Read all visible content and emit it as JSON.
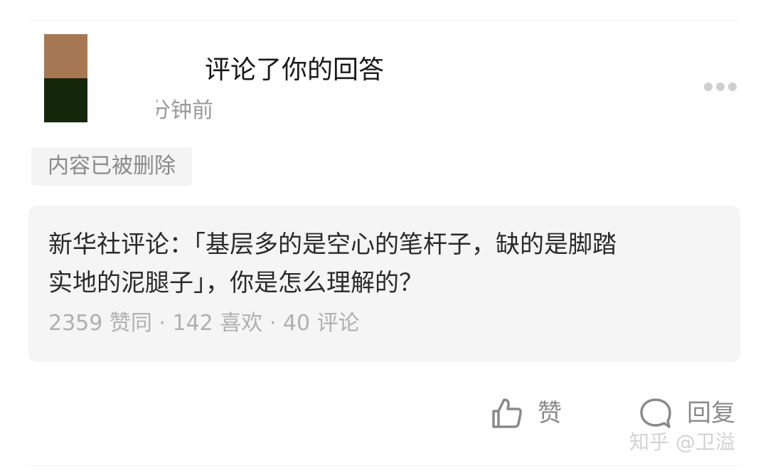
{
  "notification": {
    "action_text": "评论了你的回答",
    "time_suffix": "分钟前"
  },
  "deleted_tag": "内容已被删除",
  "question": {
    "title_line1": "新华社评论：「基层多的是空心的笔杆子，缺的是脚踏",
    "title_line2": "实地的泥腿子」，你是怎么理解的？",
    "stats": "2359 赞同 · 142 喜欢 · 40 评论"
  },
  "actions": {
    "like_label": "赞",
    "reply_label": "回复"
  },
  "watermark": "知乎 @卫溢",
  "icons": {
    "like": "thumbs-up-icon",
    "reply": "speech-bubble-icon",
    "more": "more-dots-icon"
  },
  "colors": {
    "avatar_top": "#a77854",
    "avatar_bottom": "#14270a",
    "card_bg": "#f5f5f5",
    "muted_text": "#9a9a9a"
  }
}
